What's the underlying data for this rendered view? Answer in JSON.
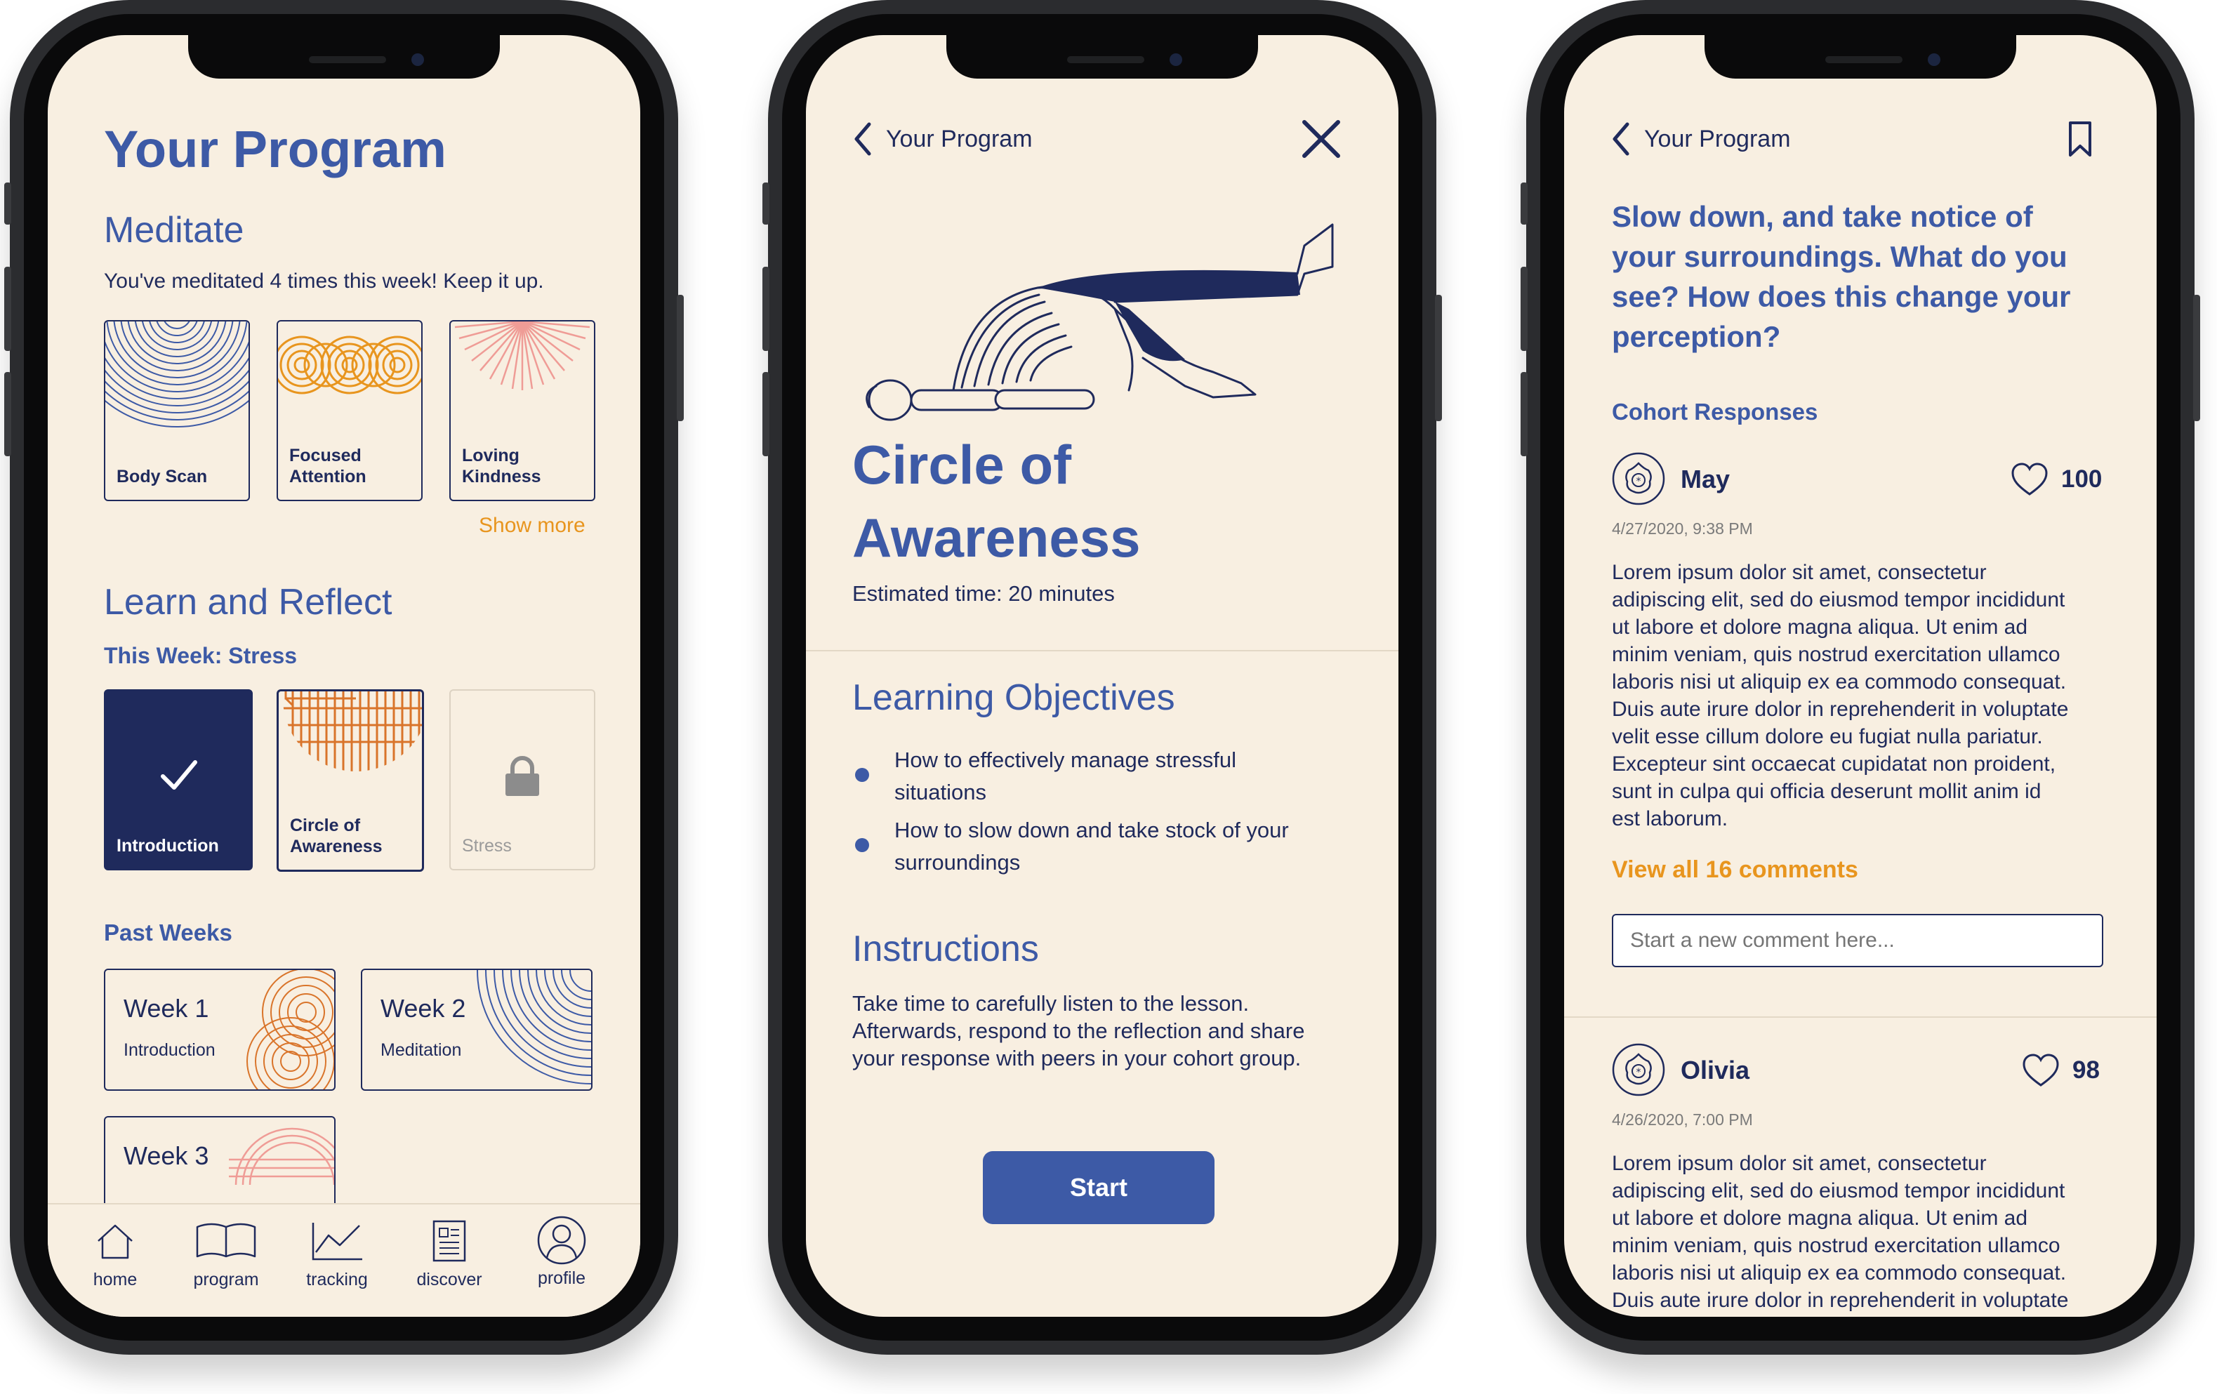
{
  "colors": {
    "cream": "#f8efe1",
    "navy": "#1f2a5c",
    "blue": "#3d5aa6",
    "orange": "#e8951e",
    "grey": "#8c8c8c"
  },
  "screen1": {
    "title": "Your Program",
    "meditate": {
      "heading": "Meditate",
      "status": "You've meditated 4 times this week! Keep it up.",
      "cards": [
        {
          "label": "Body Scan",
          "icon": "concentric-arcs-pattern"
        },
        {
          "label": "Focused Attention",
          "icon": "orange-rings-pattern"
        },
        {
          "label": "Loving Kindness",
          "icon": "pink-rays-pattern"
        }
      ],
      "show_more": "Show more"
    },
    "learn": {
      "heading": "Learn and Reflect",
      "subheading": "This Week: Stress",
      "cards": [
        {
          "label": "Introduction",
          "state": "completed",
          "icon": "check-icon"
        },
        {
          "label": "Circle of Awareness",
          "state": "current",
          "icon": "orange-stripes-pattern"
        },
        {
          "label": "Stress",
          "state": "locked",
          "icon": "lock-icon"
        }
      ]
    },
    "past": {
      "heading": "Past Weeks",
      "weeks": [
        {
          "title": "Week 1",
          "subtitle": "Introduction"
        },
        {
          "title": "Week 2",
          "subtitle": "Meditation"
        },
        {
          "title": "Week 3",
          "subtitle": ""
        }
      ]
    },
    "nav": [
      {
        "label": "home",
        "icon": "home-icon"
      },
      {
        "label": "program",
        "icon": "book-icon"
      },
      {
        "label": "tracking",
        "icon": "chart-icon"
      },
      {
        "label": "discover",
        "icon": "newspaper-icon"
      },
      {
        "label": "profile",
        "icon": "profile-icon"
      }
    ]
  },
  "screen2": {
    "back_label": "Your Program",
    "title_line1": "Circle of",
    "title_line2": "Awareness",
    "estimated": "Estimated time: 20 minutes",
    "objectives_heading": "Learning Objectives",
    "objectives": [
      {
        "line1": "How to effectively manage stressful",
        "line2": "situations"
      },
      {
        "line1": "How to slow down and take stock of your",
        "line2": "surroundings"
      }
    ],
    "instructions_heading": "Instructions",
    "instructions": [
      "Take time to carefully listen to the lesson.",
      "Afterwards, respond to the reflection and share",
      "your response with peers in your cohort group."
    ],
    "start_label": "Start"
  },
  "screen3": {
    "back_label": "Your Program",
    "question": [
      "Slow down, and take notice of",
      "your surroundings. What do you",
      "see? How does this change your",
      "perception?"
    ],
    "cohort_heading": "Cohort Responses",
    "comments": [
      {
        "name": "May",
        "likes": "100",
        "date": "4/27/2020, 9:38 PM",
        "lines": [
          "Lorem ipsum dolor sit amet, consectetur",
          "adipiscing elit, sed do eiusmod tempor incididunt",
          "ut labore et dolore magna aliqua. Ut enim ad",
          "minim veniam, quis nostrud exercitation ullamco",
          "laboris nisi ut aliquip ex ea commodo consequat.",
          "Duis aute irure dolor in reprehenderit in voluptate",
          "velit esse cillum dolore eu fugiat nulla pariatur.",
          "Excepteur sint occaecat cupidatat non proident,",
          "sunt in culpa qui officia deserunt mollit anim id",
          "est laborum."
        ]
      },
      {
        "name": "Olivia",
        "likes": "98",
        "date": "4/26/2020, 7:00 PM",
        "lines": [
          "Lorem ipsum dolor sit amet, consectetur",
          "adipiscing elit, sed do eiusmod tempor incididunt",
          "ut labore et dolore magna aliqua. Ut enim ad",
          "minim veniam, quis nostrud exercitation ullamco",
          "laboris nisi ut aliquip ex ea commodo consequat.",
          "Duis aute irure dolor in reprehenderit in voluptate"
        ]
      }
    ],
    "view_all": "View all 16 comments",
    "comment_placeholder": "Start a new comment here..."
  }
}
